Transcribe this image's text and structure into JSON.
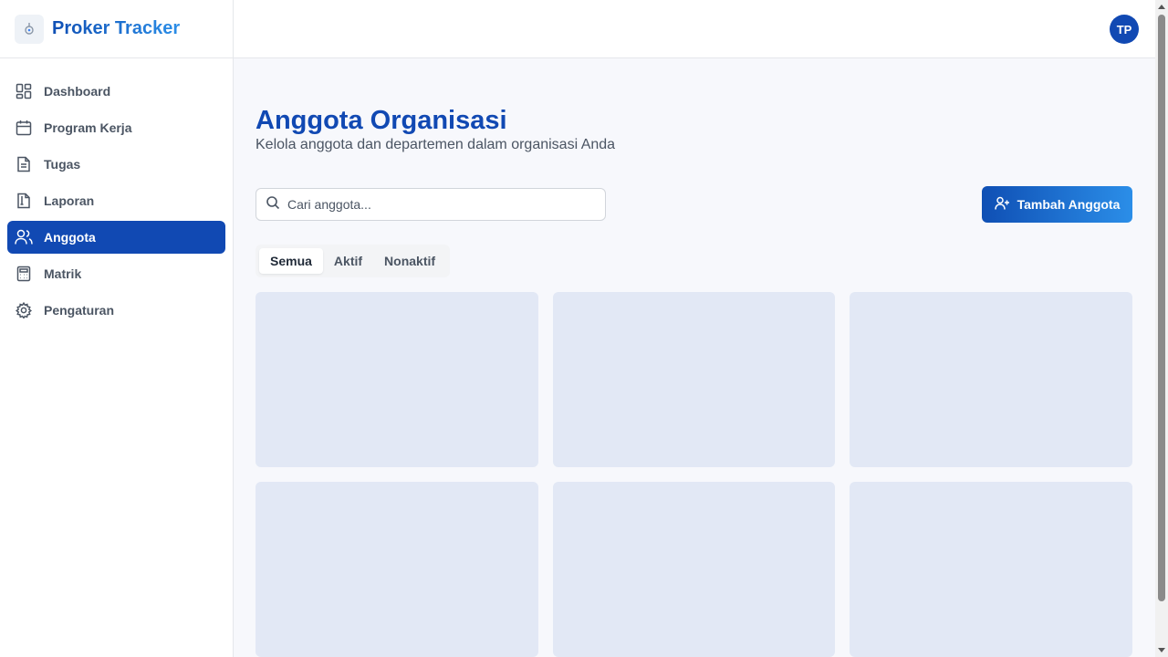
{
  "brand": {
    "title": "Proker Tracker"
  },
  "sidebar": {
    "items": [
      {
        "label": "Dashboard",
        "icon": "dashboard-icon",
        "active": false
      },
      {
        "label": "Program Kerja",
        "icon": "calendar-icon",
        "active": false
      },
      {
        "label": "Tugas",
        "icon": "document-icon",
        "active": false
      },
      {
        "label": "Laporan",
        "icon": "report-icon",
        "active": false
      },
      {
        "label": "Anggota",
        "icon": "users-icon",
        "active": true
      },
      {
        "label": "Matrik",
        "icon": "calculator-icon",
        "active": false
      },
      {
        "label": "Pengaturan",
        "icon": "gear-icon",
        "active": false
      }
    ]
  },
  "header": {
    "avatar_initials": "TP"
  },
  "main": {
    "title": "Anggota Organisasi",
    "subtitle": "Kelola anggota dan departemen dalam organisasi Anda",
    "search": {
      "placeholder": "Cari anggota...",
      "value": ""
    },
    "add_button_label": "Tambah Anggota",
    "tabs": [
      {
        "label": "Semua",
        "active": true
      },
      {
        "label": "Aktif",
        "active": false
      },
      {
        "label": "Nonaktif",
        "active": false
      }
    ]
  },
  "colors": {
    "primary": "#1149b3",
    "accent": "#2b8ee8",
    "skeleton": "#e2e8f5",
    "background": "#f7f8fc"
  }
}
